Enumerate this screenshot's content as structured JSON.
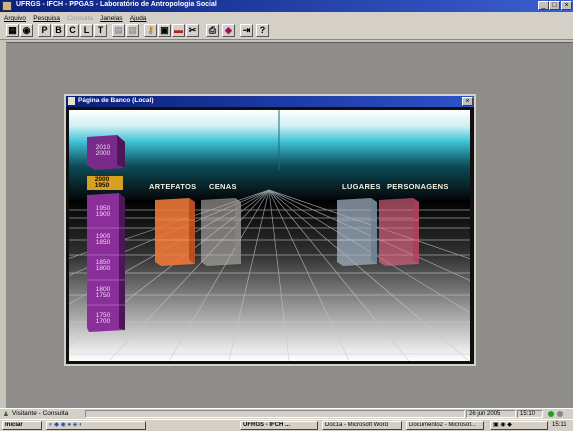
{
  "app": {
    "title": "UFRGS - IFCH - PPGAS - Laboratório de Antropologia Social",
    "window_buttons": [
      "_",
      "□",
      "×"
    ]
  },
  "menu": {
    "items": [
      {
        "label": "Arquivo",
        "enabled": true
      },
      {
        "label": "Pesquisa",
        "enabled": true
      },
      {
        "label": "Consulta",
        "enabled": false
      },
      {
        "label": "Janelas",
        "enabled": true
      },
      {
        "label": "Ajuda",
        "enabled": true
      }
    ]
  },
  "toolbar": {
    "letters": [
      "P",
      "B",
      "C",
      "L",
      "T"
    ]
  },
  "inner_window": {
    "title": "Página de Banco (Local)",
    "close_label": "×"
  },
  "scene": {
    "categories": [
      "ARTEFATOS",
      "CENAS",
      "LUGARES",
      "PERSONAGENS"
    ],
    "timeline": {
      "top_label": "2010\n2000",
      "highlight": "2000\n1950",
      "ranges": [
        "1950\n1900",
        "1900\n1850",
        "1850\n1800",
        "1800\n1750",
        "1750\n1700"
      ]
    }
  },
  "status": {
    "left": "Visitante - Consulta",
    "date": "26 jun 2005",
    "time": "15:10"
  },
  "taskbar": {
    "start": "Iniciar",
    "tasks": [
      "UFRGS - IFCH ...",
      "Doc1a - Microsoft Word",
      "Documento2 - Microsof..."
    ],
    "clock": "15:11"
  },
  "colors": {
    "titlebar": "#0a1f7a",
    "sky": "#3ec3d6",
    "timeline": "#8a2f9a",
    "artefatos": "#f07a3a",
    "personagens": "#f06c8a"
  }
}
